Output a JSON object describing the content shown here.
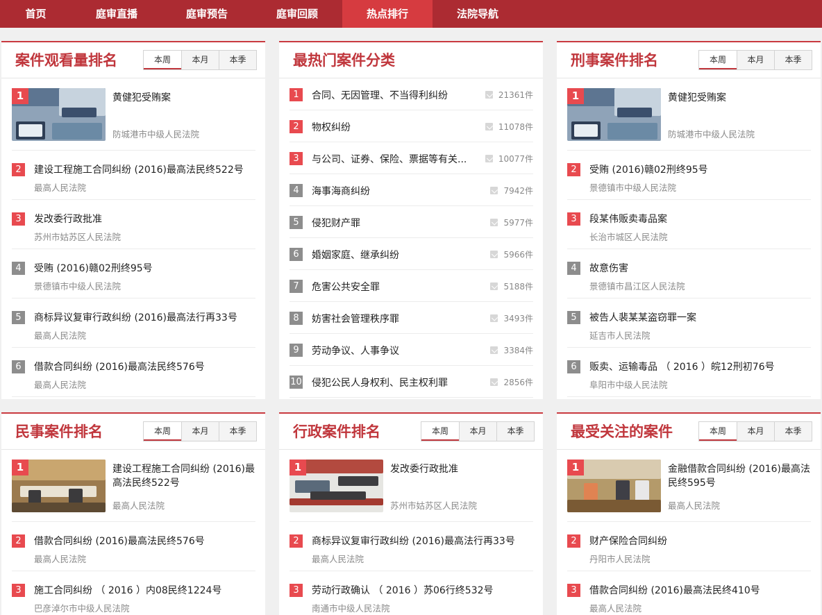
{
  "nav": [
    "首页",
    "庭审直播",
    "庭审预告",
    "庭审回顾",
    "热点排行",
    "法院导航"
  ],
  "tabs": [
    "本周",
    "本月",
    "本季"
  ],
  "panels": {
    "views": {
      "title": "案件观看量排名",
      "items": [
        {
          "rank": "1",
          "title": "黄健犯受贿案",
          "court": "防城港市中级人民法院"
        },
        {
          "rank": "2",
          "title": "建设工程施工合同纠纷 (2016)最高法民终522号",
          "court": "最高人民法院"
        },
        {
          "rank": "3",
          "title": "发改委行政批准",
          "court": "苏州市姑苏区人民法院"
        },
        {
          "rank": "4",
          "title": "受贿 (2016)赣02刑终95号",
          "court": "景德镇市中级人民法院"
        },
        {
          "rank": "5",
          "title": "商标异议复审行政纠纷 (2016)最高法行再33号",
          "court": "最高人民法院"
        },
        {
          "rank": "6",
          "title": "借款合同纠纷 (2016)最高法民终576号",
          "court": "最高人民法院"
        }
      ]
    },
    "categories": {
      "title": "最热门案件分类",
      "items": [
        {
          "rank": "1",
          "name": "合同、无因管理、不当得利纠纷",
          "count": "21361件"
        },
        {
          "rank": "2",
          "name": "物权纠纷",
          "count": "11078件"
        },
        {
          "rank": "3",
          "name": "与公司、证券、保险、票据等有关...",
          "count": "10077件"
        },
        {
          "rank": "4",
          "name": "海事海商纠纷",
          "count": "7942件"
        },
        {
          "rank": "5",
          "name": "侵犯财产罪",
          "count": "5977件"
        },
        {
          "rank": "6",
          "name": "婚姻家庭、继承纠纷",
          "count": "5966件"
        },
        {
          "rank": "7",
          "name": "危害公共安全罪",
          "count": "5188件"
        },
        {
          "rank": "8",
          "name": "妨害社会管理秩序罪",
          "count": "3493件"
        },
        {
          "rank": "9",
          "name": "劳动争议、人事争议",
          "count": "3384件"
        },
        {
          "rank": "10",
          "name": "侵犯公民人身权利、民主权利罪",
          "count": "2856件"
        }
      ]
    },
    "criminal": {
      "title": "刑事案件排名",
      "items": [
        {
          "rank": "1",
          "title": "黄健犯受贿案",
          "court": "防城港市中级人民法院"
        },
        {
          "rank": "2",
          "title": "受贿 (2016)赣02刑终95号",
          "court": "景德镇市中级人民法院"
        },
        {
          "rank": "3",
          "title": "段某伟贩卖毒品案",
          "court": "长治市城区人民法院"
        },
        {
          "rank": "4",
          "title": "故意伤害",
          "court": "景德镇市昌江区人民法院"
        },
        {
          "rank": "5",
          "title": "被告人裴某某盗窃罪一案",
          "court": "延吉市人民法院"
        },
        {
          "rank": "6",
          "title": "贩卖、运输毒品 （ 2016 ）皖12刑初76号",
          "court": "阜阳市中级人民法院"
        }
      ]
    },
    "civil": {
      "title": "民事案件排名",
      "items": [
        {
          "rank": "1",
          "title": "建设工程施工合同纠纷 (2016)最高法民终522号",
          "court": "最高人民法院"
        },
        {
          "rank": "2",
          "title": "借款合同纠纷 (2016)最高法民终576号",
          "court": "最高人民法院"
        },
        {
          "rank": "3",
          "title": "施工合同纠纷 （ 2016 ）内08民终1224号",
          "court": "巴彦淖尔市中级人民法院"
        }
      ]
    },
    "admin": {
      "title": "行政案件排名",
      "items": [
        {
          "rank": "1",
          "title": "发改委行政批准",
          "court": "苏州市姑苏区人民法院"
        },
        {
          "rank": "2",
          "title": "商标异议复审行政纠纷 (2016)最高法行再33号",
          "court": "最高人民法院"
        },
        {
          "rank": "3",
          "title": "劳动行政确认 （ 2016 ）苏06行终532号",
          "court": "南通市中级人民法院"
        }
      ]
    },
    "followed": {
      "title": "最受关注的案件",
      "items": [
        {
          "rank": "1",
          "title": "金融借款合同纠纷 (2016)最高法民终595号",
          "court": "最高人民法院"
        },
        {
          "rank": "2",
          "title": "财产保险合同纠纷",
          "court": "丹阳市人民法院"
        },
        {
          "rank": "3",
          "title": "借款合同纠纷 (2016)最高法民终410号",
          "court": "最高人民法院"
        }
      ]
    }
  }
}
